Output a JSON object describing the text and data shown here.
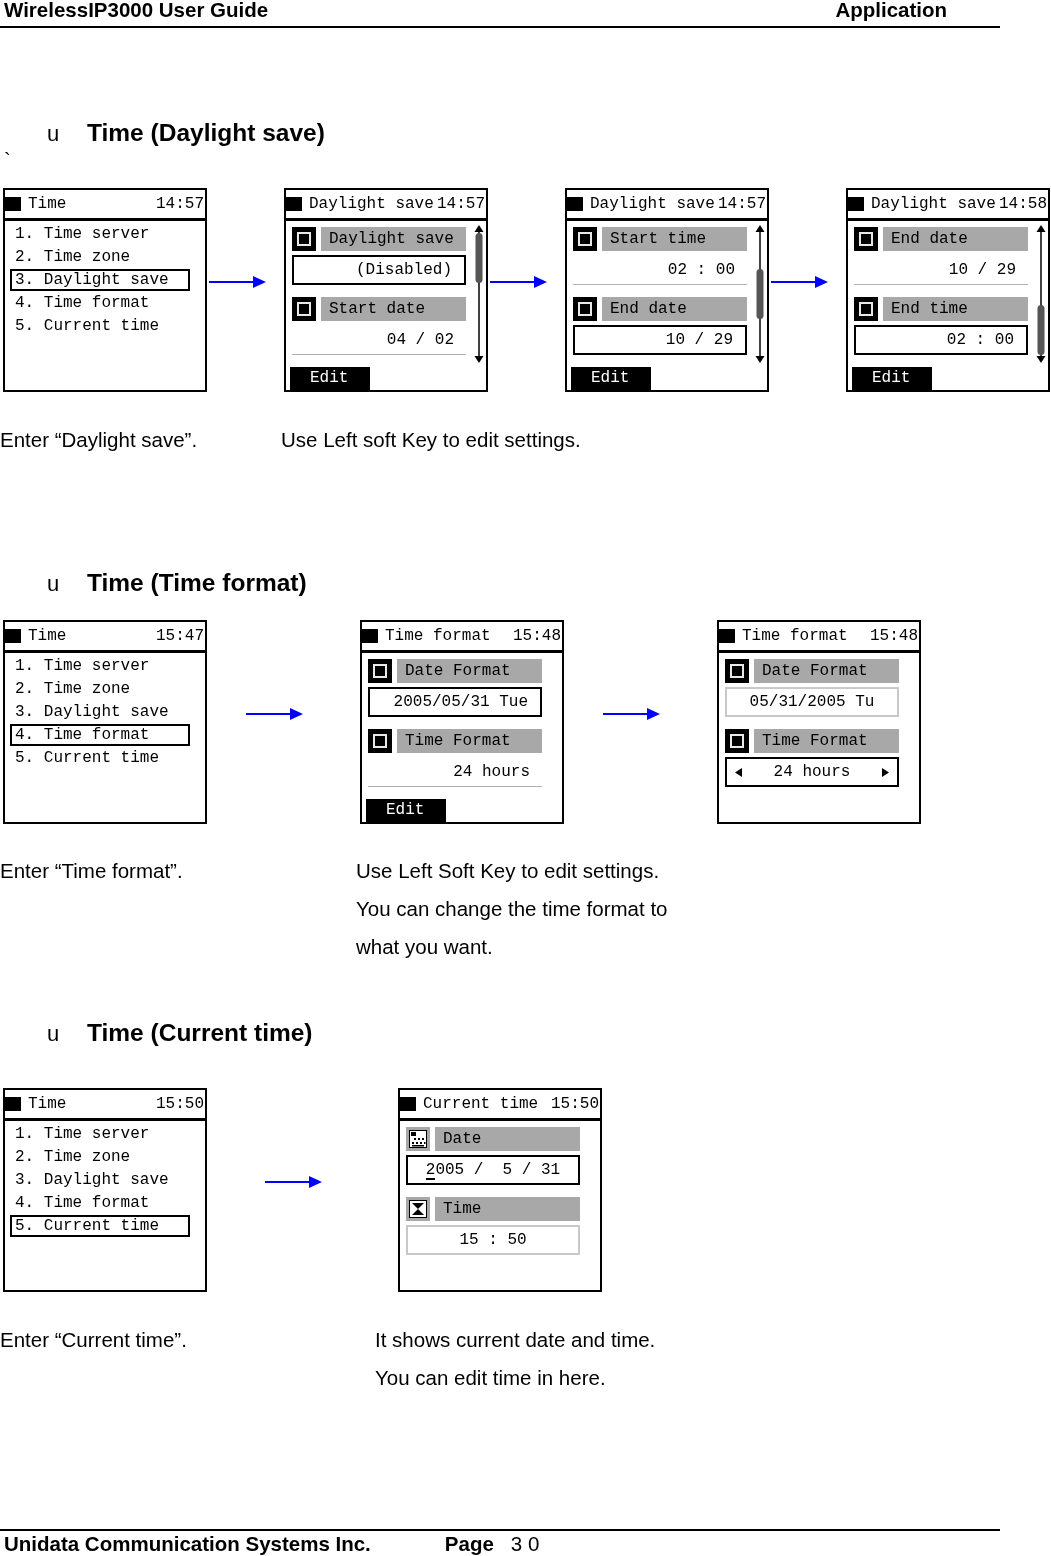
{
  "header": {
    "title": "WirelessIP3000 User Guide",
    "chapter": "Application"
  },
  "sections": [
    {
      "bullet": "u",
      "title": "Time (Daylight save)",
      "stray_mark": "`",
      "screens": [
        {
          "kind": "menu",
          "title": "Time",
          "time": "14:57",
          "items": [
            {
              "label": "1. Time server",
              "selected": false
            },
            {
              "label": "2. Time zone",
              "selected": false
            },
            {
              "label": "3. Daylight save",
              "selected": true
            },
            {
              "label": "4. Time format",
              "selected": false
            },
            {
              "label": "5. Current time",
              "selected": false
            }
          ]
        },
        {
          "kind": "settings",
          "editing": false,
          "scrollbar": true,
          "title": "Daylight save",
          "time": "14:57",
          "softkey": "Edit",
          "fields": [
            {
              "kind": "setting",
              "label": "Daylight save",
              "value": "(Disabled)",
              "selected": true
            },
            {
              "kind": "setting",
              "label": "Start date",
              "value": "04 / 02",
              "selected": false
            }
          ]
        },
        {
          "kind": "settings",
          "editing": false,
          "scrollbar": true,
          "title": "Daylight save",
          "time": "14:57",
          "softkey": "Edit",
          "fields": [
            {
              "kind": "setting",
              "label": "Start time",
              "value": "02 : 00",
              "selected": false
            },
            {
              "kind": "setting",
              "label": "End date",
              "value": "10 / 29",
              "selected": true
            }
          ]
        },
        {
          "kind": "settings",
          "editing": false,
          "scrollbar": true,
          "title": "Daylight save",
          "time": "14:58",
          "softkey": "Edit",
          "fields": [
            {
              "kind": "setting",
              "label": "End date",
              "value": "10 / 29",
              "selected": false
            },
            {
              "kind": "setting",
              "label": "End time",
              "value": "02 : 00",
              "selected": true
            }
          ]
        }
      ],
      "captions": [
        {
          "paragraphs": [
            "Enter “Daylight save”."
          ]
        },
        {
          "paragraphs": [
            "Use Left soft Key to edit settings."
          ]
        }
      ]
    },
    {
      "bullet": "u",
      "title": "Time (Time format)",
      "screens": [
        {
          "kind": "menu",
          "title": "Time",
          "time": "15:47",
          "items": [
            {
              "label": "1. Time server",
              "selected": false
            },
            {
              "label": "2. Time zone",
              "selected": false
            },
            {
              "label": "3. Daylight save",
              "selected": false
            },
            {
              "label": "4. Time format",
              "selected": true
            },
            {
              "label": "5. Current time",
              "selected": false
            }
          ]
        },
        {
          "kind": "settings",
          "editing": false,
          "scrollbar": false,
          "title": "Time format",
          "time": "15:48",
          "softkey": "Edit",
          "fields": [
            {
              "kind": "setting",
              "label": "Date Format",
              "value": "2005/05/31 Tue",
              "selected": true
            },
            {
              "kind": "setting",
              "label": "Time Format",
              "value": "24 hours",
              "selected": false
            }
          ]
        },
        {
          "kind": "settings",
          "editing": true,
          "scrollbar": false,
          "title": "Time format",
          "time": "15:48",
          "fields": [
            {
              "kind": "setting",
              "label": "Date Format",
              "value": "05/31/2005 Tu",
              "selected": false
            },
            {
              "kind": "choice",
              "label": "Time Format",
              "value": "24 hours",
              "selected": true
            }
          ]
        }
      ],
      "captions": [
        {
          "paragraphs": [
            "Enter “Time format”."
          ]
        },
        {
          "paragraphs": [
            "Use Left Soft Key to edit settings.",
            "You can change the time format to what you want."
          ]
        }
      ]
    },
    {
      "bullet": "u",
      "title": "Time (Current time)",
      "screens": [
        {
          "kind": "menu",
          "title": "Time",
          "time": "15:50",
          "items": [
            {
              "label": "1. Time server",
              "selected": false
            },
            {
              "label": "2. Time zone",
              "selected": false
            },
            {
              "label": "3. Daylight save",
              "selected": false
            },
            {
              "label": "4. Time format",
              "selected": false
            },
            {
              "label": "5. Current time",
              "selected": true
            }
          ]
        },
        {
          "kind": "settings",
          "editing": true,
          "scrollbar": false,
          "title": "Current time",
          "time": "15:50",
          "fields": [
            {
              "kind": "date",
              "label": "Date",
              "value": "2005 /  5 / 31",
              "selected": true,
              "cursor": true
            },
            {
              "kind": "time",
              "label": "Time",
              "value": "15 : 50",
              "selected": false
            }
          ]
        }
      ],
      "captions": [
        {
          "paragraphs": [
            "Enter “Current time”."
          ]
        },
        {
          "paragraphs": [
            "It shows current date and time.",
            "You can edit time in here."
          ]
        }
      ]
    }
  ],
  "footer": {
    "company": "Unidata Communication Systems Inc.",
    "page_label": "Page",
    "page_number": "3 0"
  }
}
